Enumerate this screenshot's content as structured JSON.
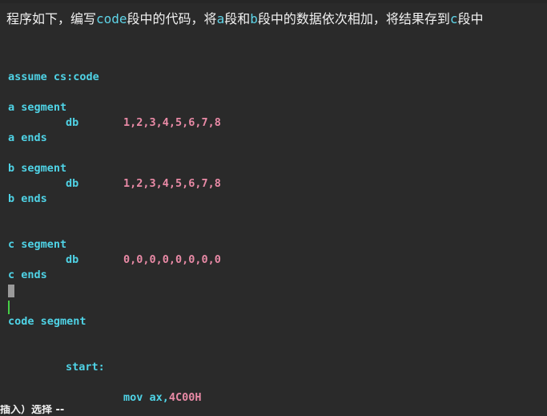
{
  "instruction": {
    "t1": "程序如下，编写",
    "k1": "code",
    "t2": "段中的代码，将",
    "k2": "a",
    "t3": "段和",
    "k3": "b",
    "t4": "段中的数据依次相加，将结果存到",
    "k4": "c",
    "t5": "段中"
  },
  "code": {
    "assume": "assume cs:code",
    "a_segment": "a segment",
    "a_db_kw": "db",
    "a_db_vals": "1,2,3,4,5,6,7,8",
    "a_ends": "a ends",
    "b_segment": "b segment",
    "b_db_kw": "db",
    "b_db_vals": "1,2,3,4,5,6,7,8",
    "b_ends": "b ends",
    "c_segment": "c segment",
    "c_db_kw": "db",
    "c_db_vals": "0,0,0,0,0,0,0,0",
    "c_ends": "c ends",
    "code_segment": "code segment",
    "start_label": "start:",
    "mov_kw": "mov ax,",
    "mov_val": "4C00H"
  },
  "status": {
    "mode": "插入）选择 --"
  },
  "colors": {
    "background": "#2a2a2a",
    "keyword": "#4fd3e6",
    "number": "#e98aa6",
    "cursor_bar": "#46d046"
  }
}
